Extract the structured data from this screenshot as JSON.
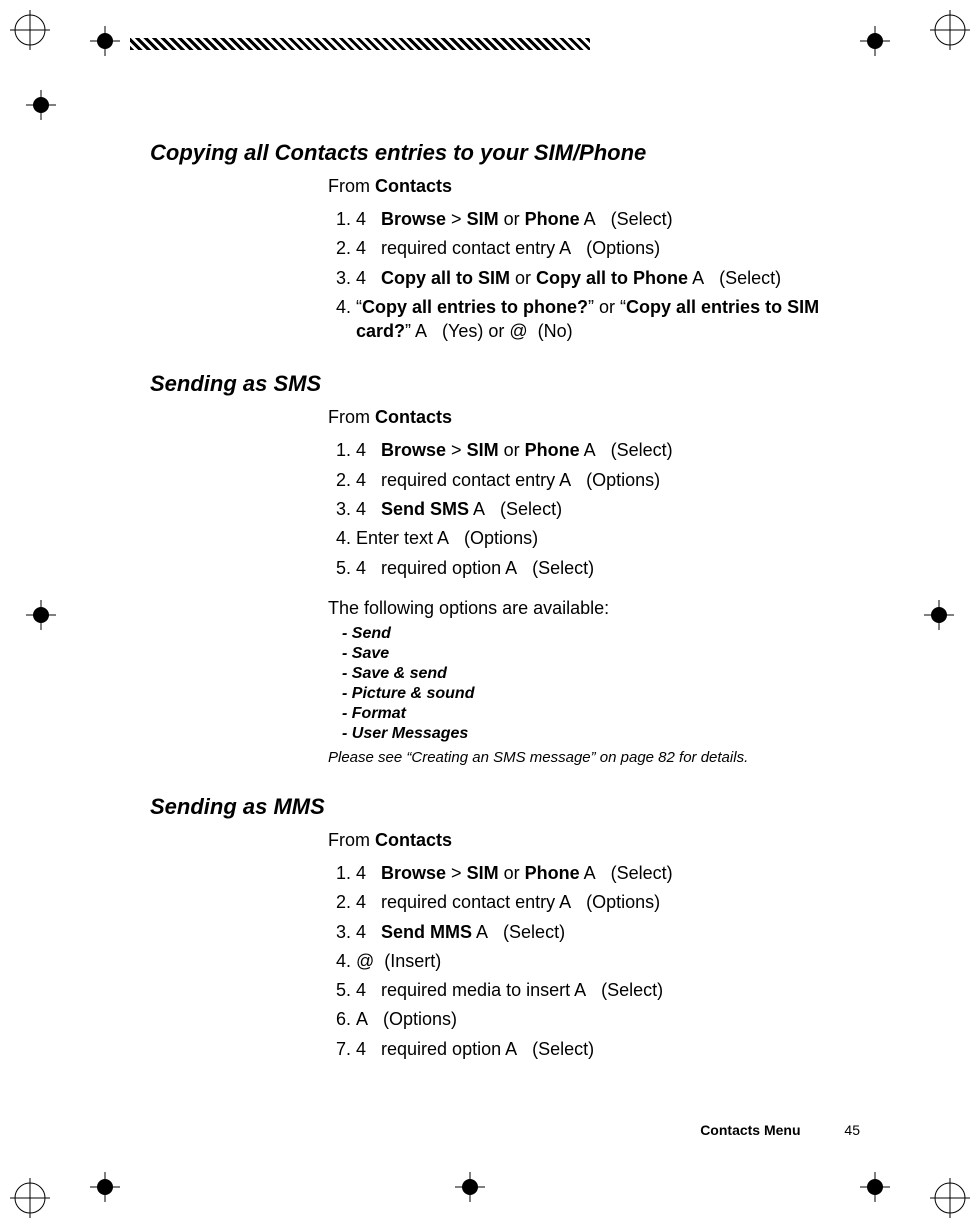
{
  "sections": {
    "copying": {
      "title": "Copying all Contacts entries to your SIM/Phone",
      "from_label": "From",
      "from_value": "Contacts",
      "steps": [
        "4&nbsp;&nbsp;&nbsp;<b>Browse</b> &gt; <b>SIM</b> or <b>Phone</b> A&nbsp;&nbsp;&nbsp;(Select)",
        "4&nbsp;&nbsp;&nbsp;required contact entry A&nbsp;&nbsp;&nbsp;(Options)",
        "4&nbsp;&nbsp;&nbsp;<b>Copy all to SIM</b> or <b>Copy all to Phone</b> A&nbsp;&nbsp;&nbsp;(Select)",
        "&ldquo;<b>Copy all entries to phone?</b>&rdquo; or &ldquo;<b>Copy all entries to SIM card?</b>&rdquo; A&nbsp;&nbsp;&nbsp;(Yes) or @&nbsp;&nbsp;(No)"
      ]
    },
    "sms": {
      "title": "Sending as SMS",
      "from_label": "From",
      "from_value": "Contacts",
      "steps": [
        "4&nbsp;&nbsp;&nbsp;<b>Browse</b> &gt; <b>SIM</b> or <b>Phone</b> A&nbsp;&nbsp;&nbsp;(Select)",
        "4&nbsp;&nbsp;&nbsp;required contact entry A&nbsp;&nbsp;&nbsp;(Options)",
        "4&nbsp;&nbsp;&nbsp;<b>Send SMS</b> A&nbsp;&nbsp;&nbsp;(Select)",
        "Enter text A&nbsp;&nbsp;&nbsp;(Options)",
        "4&nbsp;&nbsp;&nbsp;required option A&nbsp;&nbsp;&nbsp;(Select)"
      ],
      "options_intro": "The following options are available:",
      "options": [
        "Send",
        "Save",
        "Save & send",
        "Picture & sound",
        "Format",
        "User Messages"
      ],
      "note": "Please see “Creating an SMS message” on page 82 for details."
    },
    "mms": {
      "title": "Sending as MMS",
      "from_label": "From",
      "from_value": "Contacts",
      "steps": [
        "4&nbsp;&nbsp;&nbsp;<b>Browse</b> &gt; <b>SIM</b> or <b>Phone</b> A&nbsp;&nbsp;&nbsp;(Select)",
        "4&nbsp;&nbsp;&nbsp;required contact entry A&nbsp;&nbsp;&nbsp;(Options)",
        "4&nbsp;&nbsp;&nbsp;<b>Send MMS</b> A&nbsp;&nbsp;&nbsp;(Select)",
        "@&nbsp;&nbsp;(Insert)",
        "4&nbsp;&nbsp;&nbsp;required media to insert A&nbsp;&nbsp;&nbsp;(Select)",
        "A&nbsp;&nbsp;&nbsp;(Options)",
        "4&nbsp;&nbsp;&nbsp;required option A&nbsp;&nbsp;&nbsp;(Select)"
      ]
    }
  },
  "footer": {
    "title": "Contacts Menu",
    "page": "45"
  }
}
